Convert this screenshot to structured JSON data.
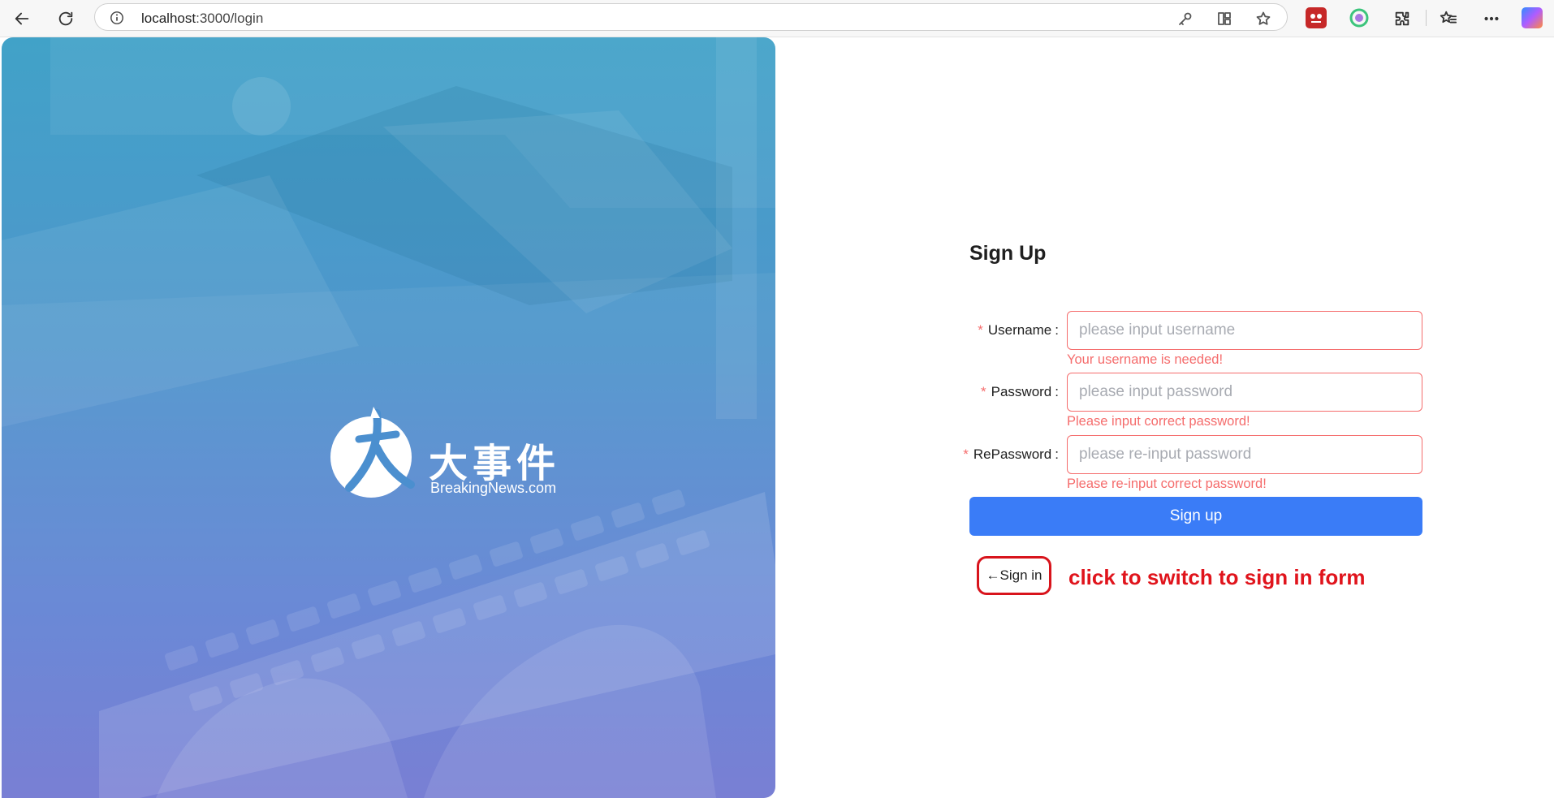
{
  "browser": {
    "url_host": "localhost",
    "url_path": ":3000/login",
    "icons": [
      "back-icon",
      "reload-icon",
      "info-icon",
      "key-icon",
      "app-grid-icon",
      "favorite-star-icon",
      "extensions-icon",
      "favorites-icon",
      "more-icon",
      "copilot-icon"
    ]
  },
  "hero": {
    "logo_cn": "大事件",
    "logo_en": "BreakingNews.com",
    "gradient_top": "#41a2c8",
    "gradient_bottom": "#7279d2"
  },
  "form": {
    "title": "Sign Up",
    "fields": [
      {
        "label": "Username",
        "placeholder": "please input username",
        "error": "Your username is needed!"
      },
      {
        "label": "Password",
        "placeholder": "please input password",
        "error": "Please input correct password!"
      },
      {
        "label": "RePassword",
        "placeholder": "please re-input password",
        "error": "Please re-input correct password!"
      }
    ],
    "required_mark": "*",
    "label_colon": ":",
    "submit_label": "Sign up",
    "switch_label": "←Sign in",
    "annotation": "click to switch to sign in form",
    "accent_color": "#3a7cf7",
    "error_color": "#f56c6c"
  }
}
